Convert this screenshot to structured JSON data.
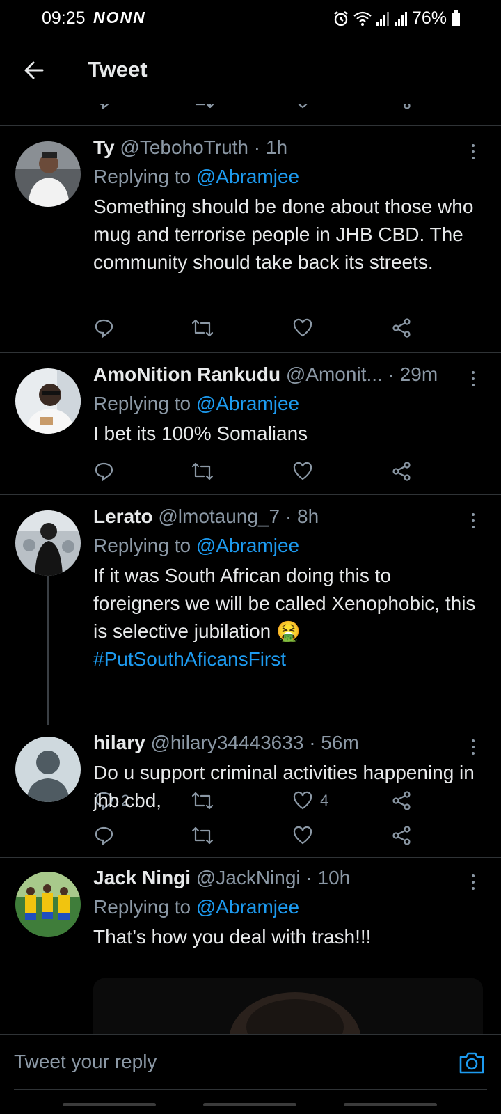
{
  "status_bar": {
    "time": "09:25",
    "left_icons": "NONN",
    "battery": "76%"
  },
  "header": {
    "title": "Tweet"
  },
  "tweets": [
    {
      "name": "Ty",
      "handle": "@TebohoTruth",
      "time": "1h",
      "replying_label": "Replying to",
      "replying_to": "@Abramjee",
      "text": "Something should be done about those who mug and terrorise people in JHB CBD. The community should take back its streets.",
      "reply_count": "",
      "like_count": ""
    },
    {
      "name": "AmoNition Rankudu",
      "handle": "@Amonit...",
      "time": "29m",
      "replying_label": "Replying to",
      "replying_to": "@Abramjee",
      "text": "I bet its 100% Somalians",
      "reply_count": "",
      "like_count": ""
    },
    {
      "name": "Lerato",
      "handle": "@lmotaung_7",
      "time": "8h",
      "replying_label": "Replying to",
      "replying_to": "@Abramjee",
      "text": "If it was South African doing this to foreigners we will be called Xenophobic, this is selective jubilation 🤮",
      "hashtag": "#PutSouthAficansFirst",
      "reply_count": "2",
      "like_count": "4"
    },
    {
      "name": "hilary",
      "handle": "@hilary34443633",
      "time": "56m",
      "text": "Do u support criminal activities happening in jhb cbd,",
      "reply_count": "",
      "like_count": ""
    },
    {
      "name": "Jack Ningi",
      "handle": "@JackNingi",
      "time": "10h",
      "replying_label": "Replying to",
      "replying_to": "@Abramjee",
      "text": "That’s how you deal with trash!!!"
    }
  ],
  "reply_bar": {
    "placeholder": "Tweet your reply"
  },
  "icons": {
    "back": "arrow-left-icon",
    "reply": "reply-icon",
    "retweet": "retweet-icon",
    "like": "heart-icon",
    "share": "share-icon",
    "camera": "camera-icon",
    "more": "more-vertical-icon"
  },
  "colors": {
    "background": "#000000",
    "accent": "#1d9bf0",
    "secondary_text": "#8b98a5",
    "divider": "#2f3336"
  }
}
